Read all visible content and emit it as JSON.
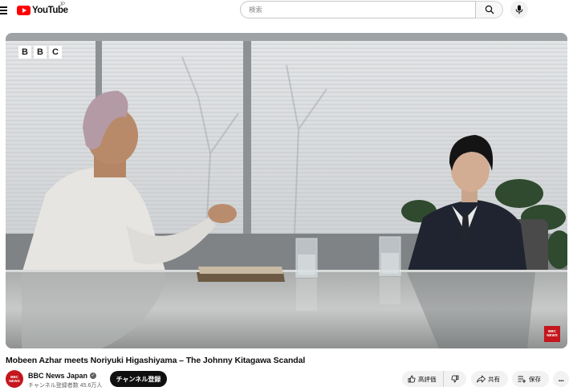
{
  "header": {
    "logo_text": "YouTube",
    "region_code": "JP",
    "search_placeholder": "検索"
  },
  "player": {
    "brand_letters": [
      "B",
      "B",
      "C"
    ],
    "corner_badge": "BBC NEWS"
  },
  "video": {
    "title": "Mobeen Azhar meets Noriyuki Higashiyama – The Johnny Kitagawa Scandal"
  },
  "channel": {
    "avatar_text": "BBC NEWS",
    "name": "BBC News Japan",
    "verified_mark": "✓",
    "subscribers": "チャンネル登録者数 45.6万人",
    "subscribe_label": "チャンネル登録"
  },
  "actions": {
    "like_label": "高評価",
    "share_label": "共有",
    "save_label": "保存",
    "more_label": "..."
  },
  "colors": {
    "brand_red": "#ff0000",
    "bbc_red": "#c4161c",
    "pill_bg": "#f2f2f2",
    "subscribe_bg": "#0f0f0f"
  }
}
